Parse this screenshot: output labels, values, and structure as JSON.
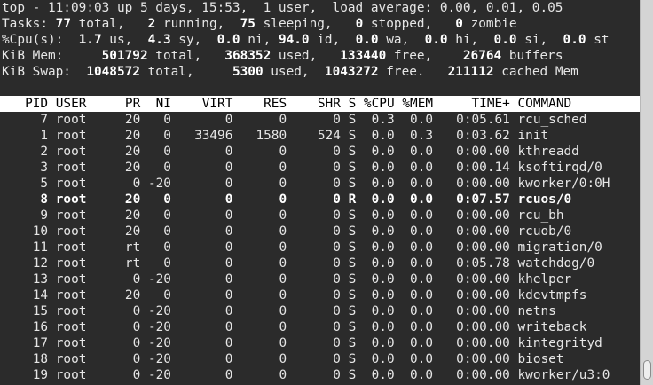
{
  "summary": {
    "top_line": "top - 11:09:03 up 5 days, 15:53,  1 user,  load average: 0.00, 0.01, 0.05",
    "tasks": {
      "label": "Tasks:",
      "total": "77",
      "total_label": " total,",
      "running": "2",
      "running_label": " running,",
      "sleeping": "75",
      "sleeping_label": " sleeping,",
      "stopped": "0",
      "stopped_label": " stopped,",
      "zombie": "0",
      "zombie_label": " zombie"
    },
    "cpu": {
      "label": "%Cpu(s):",
      "us": "1.7",
      "us_label": " us,",
      "sy": "4.3",
      "sy_label": " sy,",
      "ni": "0.0",
      "ni_label": " ni,",
      "id": "94.0",
      "id_label": " id,",
      "wa": "0.0",
      "wa_label": " wa,",
      "hi": "0.0",
      "hi_label": " hi,",
      "si": "0.0",
      "si_label": " si,",
      "st": "0.0",
      "st_label": " st"
    },
    "mem": {
      "label": "KiB Mem:",
      "total": "501792",
      "total_label": " total,",
      "used": "368352",
      "used_label": " used,",
      "free": "133440",
      "free_label": " free,",
      "buffers": "26764",
      "buffers_label": " buffers"
    },
    "swap": {
      "label": "KiB Swap:",
      "total": "1048572",
      "total_label": " total,",
      "used": "5300",
      "used_label": " used,",
      "free": "1043272",
      "free_label": " free.",
      "cached": "211112",
      "cached_label": " cached Mem"
    }
  },
  "columns": [
    "PID",
    "USER",
    "PR",
    "NI",
    "VIRT",
    "RES",
    "SHR",
    "S",
    "%CPU",
    "%MEM",
    "TIME+",
    "COMMAND"
  ],
  "processes": [
    {
      "pid": "7",
      "user": "root",
      "pr": "20",
      "ni": "0",
      "virt": "0",
      "res": "0",
      "shr": "0",
      "s": "S",
      "cpu": "0.3",
      "mem": "0.0",
      "time": "0:05.61",
      "command": "rcu_sched",
      "bold": false
    },
    {
      "pid": "1",
      "user": "root",
      "pr": "20",
      "ni": "0",
      "virt": "33496",
      "res": "1580",
      "shr": "524",
      "s": "S",
      "cpu": "0.0",
      "mem": "0.3",
      "time": "0:03.62",
      "command": "init",
      "bold": false
    },
    {
      "pid": "2",
      "user": "root",
      "pr": "20",
      "ni": "0",
      "virt": "0",
      "res": "0",
      "shr": "0",
      "s": "S",
      "cpu": "0.0",
      "mem": "0.0",
      "time": "0:00.00",
      "command": "kthreadd",
      "bold": false
    },
    {
      "pid": "3",
      "user": "root",
      "pr": "20",
      "ni": "0",
      "virt": "0",
      "res": "0",
      "shr": "0",
      "s": "S",
      "cpu": "0.0",
      "mem": "0.0",
      "time": "0:00.14",
      "command": "ksoftirqd/0",
      "bold": false
    },
    {
      "pid": "5",
      "user": "root",
      "pr": "0",
      "ni": "-20",
      "virt": "0",
      "res": "0",
      "shr": "0",
      "s": "S",
      "cpu": "0.0",
      "mem": "0.0",
      "time": "0:00.00",
      "command": "kworker/0:0H",
      "bold": false
    },
    {
      "pid": "8",
      "user": "root",
      "pr": "20",
      "ni": "0",
      "virt": "0",
      "res": "0",
      "shr": "0",
      "s": "R",
      "cpu": "0.0",
      "mem": "0.0",
      "time": "0:07.57",
      "command": "rcuos/0",
      "bold": true
    },
    {
      "pid": "9",
      "user": "root",
      "pr": "20",
      "ni": "0",
      "virt": "0",
      "res": "0",
      "shr": "0",
      "s": "S",
      "cpu": "0.0",
      "mem": "0.0",
      "time": "0:00.00",
      "command": "rcu_bh",
      "bold": false
    },
    {
      "pid": "10",
      "user": "root",
      "pr": "20",
      "ni": "0",
      "virt": "0",
      "res": "0",
      "shr": "0",
      "s": "S",
      "cpu": "0.0",
      "mem": "0.0",
      "time": "0:00.00",
      "command": "rcuob/0",
      "bold": false
    },
    {
      "pid": "11",
      "user": "root",
      "pr": "rt",
      "ni": "0",
      "virt": "0",
      "res": "0",
      "shr": "0",
      "s": "S",
      "cpu": "0.0",
      "mem": "0.0",
      "time": "0:00.00",
      "command": "migration/0",
      "bold": false
    },
    {
      "pid": "12",
      "user": "root",
      "pr": "rt",
      "ni": "0",
      "virt": "0",
      "res": "0",
      "shr": "0",
      "s": "S",
      "cpu": "0.0",
      "mem": "0.0",
      "time": "0:05.78",
      "command": "watchdog/0",
      "bold": false
    },
    {
      "pid": "13",
      "user": "root",
      "pr": "0",
      "ni": "-20",
      "virt": "0",
      "res": "0",
      "shr": "0",
      "s": "S",
      "cpu": "0.0",
      "mem": "0.0",
      "time": "0:00.00",
      "command": "khelper",
      "bold": false
    },
    {
      "pid": "14",
      "user": "root",
      "pr": "20",
      "ni": "0",
      "virt": "0",
      "res": "0",
      "shr": "0",
      "s": "S",
      "cpu": "0.0",
      "mem": "0.0",
      "time": "0:00.00",
      "command": "kdevtmpfs",
      "bold": false
    },
    {
      "pid": "15",
      "user": "root",
      "pr": "0",
      "ni": "-20",
      "virt": "0",
      "res": "0",
      "shr": "0",
      "s": "S",
      "cpu": "0.0",
      "mem": "0.0",
      "time": "0:00.00",
      "command": "netns",
      "bold": false
    },
    {
      "pid": "16",
      "user": "root",
      "pr": "0",
      "ni": "-20",
      "virt": "0",
      "res": "0",
      "shr": "0",
      "s": "S",
      "cpu": "0.0",
      "mem": "0.0",
      "time": "0:00.00",
      "command": "writeback",
      "bold": false
    },
    {
      "pid": "17",
      "user": "root",
      "pr": "0",
      "ni": "-20",
      "virt": "0",
      "res": "0",
      "shr": "0",
      "s": "S",
      "cpu": "0.0",
      "mem": "0.0",
      "time": "0:00.00",
      "command": "kintegrityd",
      "bold": false
    },
    {
      "pid": "18",
      "user": "root",
      "pr": "0",
      "ni": "-20",
      "virt": "0",
      "res": "0",
      "shr": "0",
      "s": "S",
      "cpu": "0.0",
      "mem": "0.0",
      "time": "0:00.00",
      "command": "bioset",
      "bold": false
    },
    {
      "pid": "19",
      "user": "root",
      "pr": "0",
      "ni": "-20",
      "virt": "0",
      "res": "0",
      "shr": "0",
      "s": "S",
      "cpu": "0.0",
      "mem": "0.0",
      "time": "0:00.00",
      "command": "kworker/u3:0",
      "bold": false
    }
  ],
  "colors": {
    "background": "#2b2b2b",
    "text": "#e6e6e6",
    "bold_text": "#ffffff",
    "header_bg": "#ffffff",
    "header_fg": "#000000"
  }
}
